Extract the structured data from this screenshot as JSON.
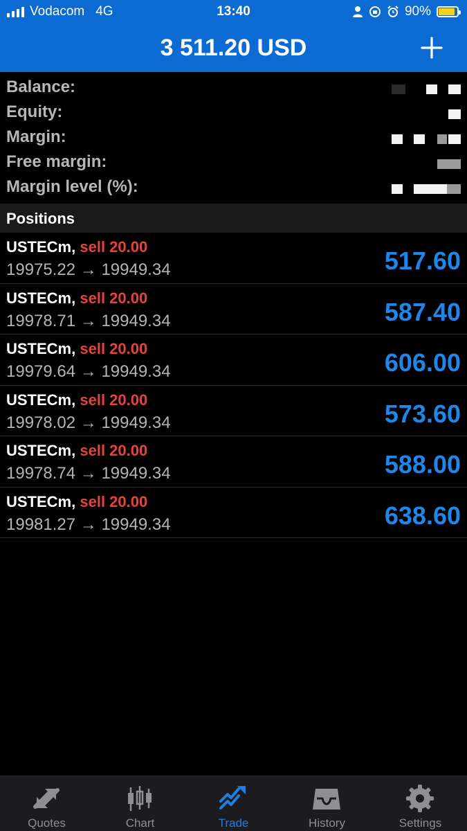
{
  "status_bar": {
    "carrier": "Vodacom",
    "network": "4G",
    "time": "13:40",
    "battery": "90%",
    "battery_level": 0.9
  },
  "header": {
    "title": "3 511.20 USD",
    "add_icon": "plus-icon"
  },
  "summary": {
    "balance_label": "Balance:",
    "equity_label": "Equity:",
    "margin_label": "Margin:",
    "free_margin_label": "Free margin:",
    "margin_level_label": "Margin level (%):"
  },
  "positions": {
    "title": "Positions",
    "items": [
      {
        "symbol": "USTECm,",
        "side": "sell 20.00",
        "route": "19975.22 → 19949.34",
        "profit": "517.60"
      },
      {
        "symbol": "USTECm,",
        "side": "sell 20.00",
        "route": "19978.71 → 19949.34",
        "profit": "587.40"
      },
      {
        "symbol": "USTECm,",
        "side": "sell 20.00",
        "route": "19979.64 → 19949.34",
        "profit": "606.00"
      },
      {
        "symbol": "USTECm,",
        "side": "sell 20.00",
        "route": "19978.02 → 19949.34",
        "profit": "573.60"
      },
      {
        "symbol": "USTECm,",
        "side": "sell 20.00",
        "route": "19978.74 → 19949.34",
        "profit": "588.00"
      },
      {
        "symbol": "USTECm,",
        "side": "sell 20.00",
        "route": "19981.27 → 19949.34",
        "profit": "638.60"
      }
    ]
  },
  "tabs": [
    {
      "label": "Quotes",
      "icon": "quotes-icon",
      "active": false
    },
    {
      "label": "Chart",
      "icon": "chart-icon",
      "active": false
    },
    {
      "label": "Trade",
      "icon": "trade-icon",
      "active": true
    },
    {
      "label": "History",
      "icon": "history-icon",
      "active": false
    },
    {
      "label": "Settings",
      "icon": "settings-icon",
      "active": false
    }
  ],
  "colors": {
    "header_bg": "#0c6bd3",
    "sell": "#e8423c",
    "profit": "#1f86ea",
    "active_tab": "#1f7ee6",
    "inactive_tab": "#8e8e93"
  }
}
